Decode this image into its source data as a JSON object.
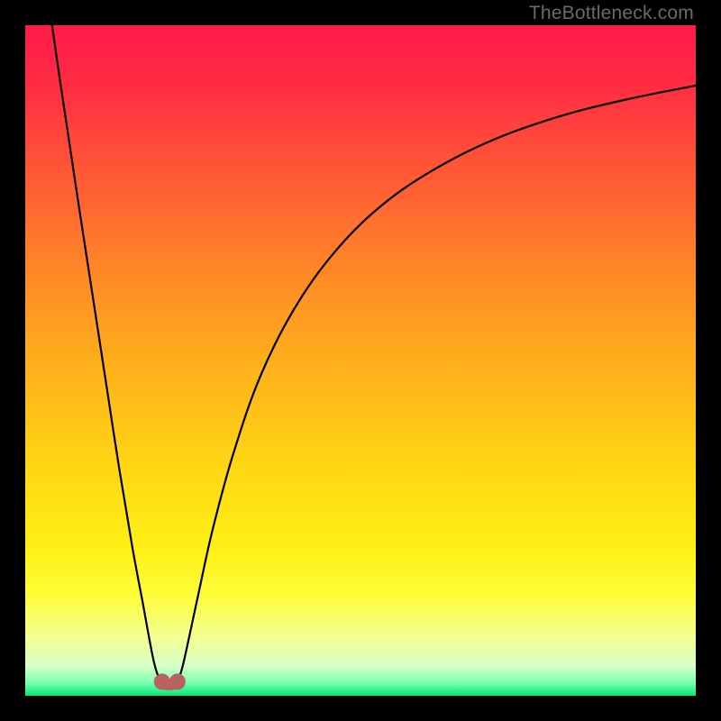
{
  "watermark": {
    "text": "TheBottleneck.com"
  },
  "colors": {
    "gradient_stops": [
      {
        "offset": 0.0,
        "color": "#ff1a49"
      },
      {
        "offset": 0.08,
        "color": "#ff2a44"
      },
      {
        "offset": 0.2,
        "color": "#ff5138"
      },
      {
        "offset": 0.35,
        "color": "#ff8228"
      },
      {
        "offset": 0.5,
        "color": "#ffae1c"
      },
      {
        "offset": 0.65,
        "color": "#ffd414"
      },
      {
        "offset": 0.78,
        "color": "#fff015"
      },
      {
        "offset": 0.85,
        "color": "#fdfd3a"
      },
      {
        "offset": 0.91,
        "color": "#f4ff90"
      },
      {
        "offset": 0.955,
        "color": "#d8ffc8"
      },
      {
        "offset": 0.98,
        "color": "#7dffb0"
      },
      {
        "offset": 1.0,
        "color": "#00e878"
      }
    ],
    "curve": "#000000",
    "marker": "#b96062",
    "frame": "#000000"
  },
  "chart_data": {
    "type": "line",
    "title": "",
    "xlabel": "",
    "ylabel": "",
    "xlim": [
      0,
      100
    ],
    "ylim": [
      0,
      100
    ],
    "grid": false,
    "series": [
      {
        "name": "left-branch",
        "x": [
          4.0,
          5.0,
          6.5,
          8.0,
          10.0,
          12.0,
          14.0,
          16.0,
          17.5,
          18.5,
          19.2,
          19.8,
          20.3
        ],
        "values": [
          100.0,
          93.0,
          83.0,
          73.0,
          60.0,
          47.0,
          34.0,
          22.0,
          14.0,
          8.5,
          5.0,
          3.0,
          2.2
        ]
      },
      {
        "name": "right-branch",
        "x": [
          22.8,
          23.5,
          24.5,
          26.0,
          28.0,
          31.0,
          35.0,
          40.0,
          46.0,
          53.0,
          61.0,
          70.0,
          80.0,
          90.0,
          100.0
        ],
        "values": [
          2.2,
          4.5,
          9.0,
          16.0,
          25.0,
          36.0,
          47.5,
          57.5,
          66.0,
          73.0,
          78.5,
          83.0,
          86.5,
          89.0,
          91.0
        ]
      },
      {
        "name": "valley-floor",
        "x": [
          20.3,
          20.8,
          21.5,
          22.2,
          22.8
        ],
        "values": [
          2.2,
          1.6,
          1.5,
          1.6,
          2.2
        ]
      }
    ],
    "markers": [
      {
        "name": "u-marker-left",
        "x": 20.4,
        "y": 2.1
      },
      {
        "name": "u-marker-right",
        "x": 22.7,
        "y": 2.1
      }
    ]
  }
}
